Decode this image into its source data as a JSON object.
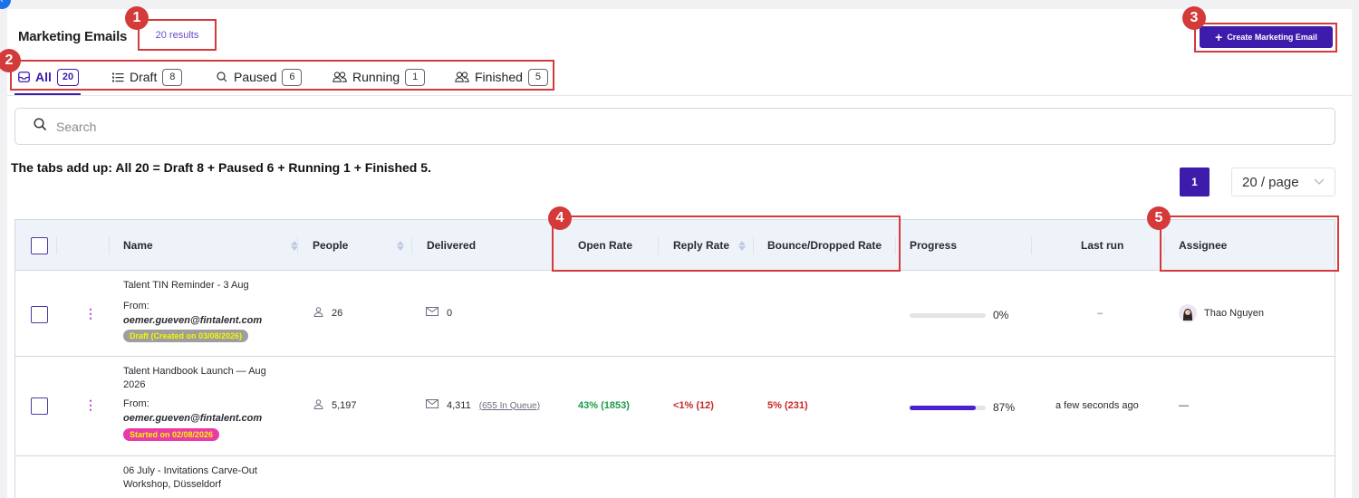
{
  "header": {
    "title": "Marketing Emails",
    "results": "20 results",
    "create_button": "Create Marketing Email"
  },
  "tabs": [
    {
      "label": "All",
      "count": "20",
      "icon": "inbox-icon",
      "active": true
    },
    {
      "label": "Draft",
      "count": "8",
      "icon": "list-icon"
    },
    {
      "label": "Paused",
      "count": "6",
      "icon": "search-icon"
    },
    {
      "label": "Running",
      "count": "1",
      "icon": "users-icon"
    },
    {
      "label": "Finished",
      "count": "5",
      "icon": "users-icon"
    }
  ],
  "search": {
    "placeholder": "Search"
  },
  "note": "The tabs add up: All 20 = Draft 8 + Paused 6 + Running 1 + Finished 5.",
  "pagination": {
    "current_page": "1",
    "page_size": "20 / page"
  },
  "markers": [
    "1",
    "2",
    "3",
    "4",
    "5"
  ],
  "table": {
    "columns": {
      "name": "Name",
      "people": "People",
      "delivered": "Delivered",
      "open_rate": "Open Rate",
      "reply_rate": "Reply Rate",
      "bounce": "Bounce/Dropped Rate",
      "progress": "Progress",
      "last_run": "Last run",
      "assignee": "Assignee"
    },
    "rows": [
      {
        "name": "Talent TIN Reminder - 3 Aug",
        "from_label": "From:",
        "from_email": "oemer.gueven@fintalent.com",
        "status": "Draft (Created on 03/08/2026)",
        "people": "26",
        "delivered": "0",
        "queue": "",
        "open_rate": "",
        "reply_rate": "",
        "bounce": "",
        "progress_value": 0,
        "progress_label": "0%",
        "last_run": "–",
        "assignee": "Thao Nguyen"
      },
      {
        "name": "Talent Handbook Launch — Aug 2026",
        "from_label": "From:",
        "from_email": "oemer.gueven@fintalent.com",
        "status": "Started on 02/08/2026",
        "people": "5,197",
        "delivered": "4,311",
        "queue": "(655 In Queue)",
        "open_rate": "43% (1853)",
        "reply_rate": "<1% (12)",
        "bounce": "5% (231)",
        "progress_value": 0.87,
        "progress_label": "87%",
        "last_run": "a few seconds ago",
        "assignee": "—"
      },
      {
        "name": "06 July - Invitations Carve-Out Workshop, Düsseldorf"
      }
    ]
  },
  "colors": {
    "accent": "#3d1bab",
    "annotation": "#d43a3a",
    "open_rate": "#1a9a4a",
    "reply_rate": "#c62828",
    "draft_badge_bg": "#9e9e9e",
    "draft_badge_text": "#f5f500",
    "started_badge_bg": "#e83aa8",
    "started_badge_text": "#f5f500"
  }
}
